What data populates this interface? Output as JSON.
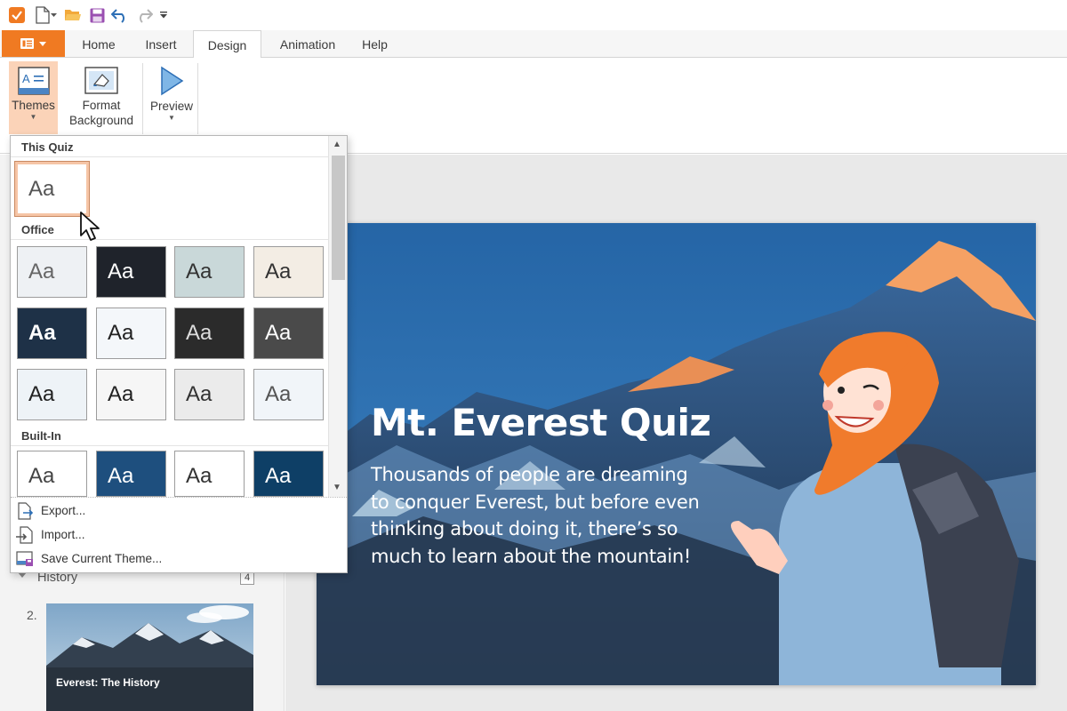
{
  "quick_access": {
    "icons": [
      "app-check-icon",
      "new-file-icon",
      "open-folder-icon",
      "save-icon",
      "undo-icon",
      "redo-icon",
      "customize-icon"
    ]
  },
  "tabs": [
    {
      "label": "Home"
    },
    {
      "label": "Insert"
    },
    {
      "label": "Design",
      "active": true
    },
    {
      "label": "Animation"
    },
    {
      "label": "Help"
    }
  ],
  "ribbon": {
    "themes_label": "Themes",
    "format_bg_line1": "Format",
    "format_bg_line2": "Background",
    "preview_label": "Preview"
  },
  "theme_menu": {
    "this_quiz_label": "This Quiz",
    "office_label": "Office",
    "builtin_label": "Built-In",
    "tile_text": "Aa",
    "export_label": "Export...",
    "import_label": "Import...",
    "save_theme_label": "Save Current Theme..."
  },
  "left_panel": {
    "group_label": "History",
    "group_count": "4",
    "slide_number": "2.",
    "slide_title": "Everest: The History"
  },
  "slide": {
    "title": "Mt. Everest Quiz",
    "subtitle": "Thousands of people are dreaming to conquer Everest, but before even thinking about doing it, there’s so much to learn about the mountain!"
  },
  "colors": {
    "accent": "#f07a22",
    "selected_bg": "#fbd3b8",
    "sky": "#2e6ba8"
  }
}
